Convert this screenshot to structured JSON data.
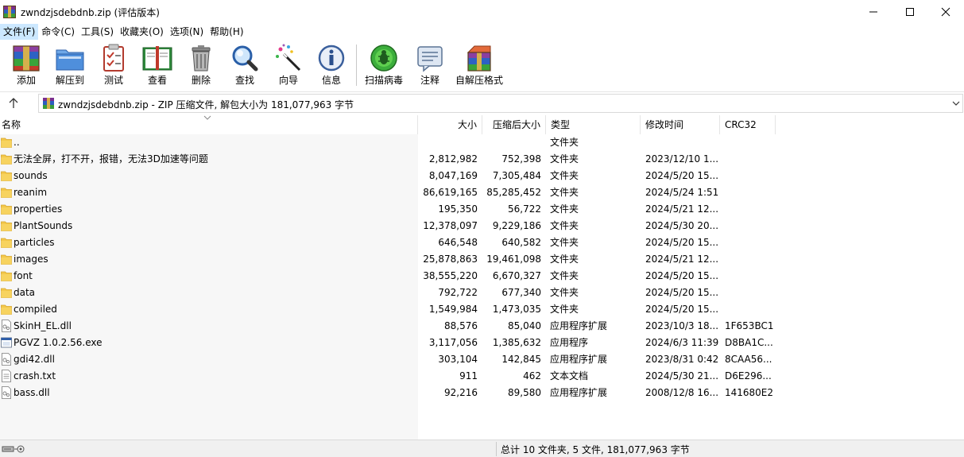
{
  "window": {
    "title": "zwndzjsdebdnb.zip (评估版本)"
  },
  "menu": [
    {
      "label": "文件(F)"
    },
    {
      "label": "命令(C)"
    },
    {
      "label": "工具(S)"
    },
    {
      "label": "收藏夹(O)"
    },
    {
      "label": "选项(N)"
    },
    {
      "label": "帮助(H)"
    }
  ],
  "toolbar": [
    {
      "label": "添加",
      "icon": "add-archive-icon"
    },
    {
      "label": "解压到",
      "icon": "extract-to-icon"
    },
    {
      "label": "测试",
      "icon": "test-icon"
    },
    {
      "label": "查看",
      "icon": "view-book-icon"
    },
    {
      "label": "删除",
      "icon": "trash-icon"
    },
    {
      "label": "查找",
      "icon": "find-magnifier-icon"
    },
    {
      "label": "向导",
      "icon": "wizard-wand-icon"
    },
    {
      "label": "信息",
      "icon": "info-icon"
    },
    {
      "label": "扫描病毒",
      "icon": "virus-scan-icon"
    },
    {
      "label": "注释",
      "icon": "comment-icon"
    },
    {
      "label": "自解压格式",
      "icon": "sfx-icon"
    }
  ],
  "address": {
    "text": "zwndzjsdebdnb.zip - ZIP 压缩文件, 解包大小为 181,077,963 字节"
  },
  "columns": {
    "name": "名称",
    "size": "大小",
    "packed": "压缩后大小",
    "type": "类型",
    "modified": "修改时间",
    "crc": "CRC32"
  },
  "files": [
    {
      "name": "..",
      "size": "",
      "packed": "",
      "type": "文件夹",
      "modified": "",
      "crc": "",
      "kind": "folder"
    },
    {
      "name": "无法全屏，打不开，报错，无法3D加速等问题",
      "size": "2,812,982",
      "packed": "752,398",
      "type": "文件夹",
      "modified": "2023/12/10 1...",
      "crc": "",
      "kind": "folder"
    },
    {
      "name": "sounds",
      "size": "8,047,169",
      "packed": "7,305,484",
      "type": "文件夹",
      "modified": "2024/5/20 15...",
      "crc": "",
      "kind": "folder"
    },
    {
      "name": "reanim",
      "size": "86,619,165",
      "packed": "85,285,452",
      "type": "文件夹",
      "modified": "2024/5/24 1:51",
      "crc": "",
      "kind": "folder"
    },
    {
      "name": "properties",
      "size": "195,350",
      "packed": "56,722",
      "type": "文件夹",
      "modified": "2024/5/21 12...",
      "crc": "",
      "kind": "folder"
    },
    {
      "name": "PlantSounds",
      "size": "12,378,097",
      "packed": "9,229,186",
      "type": "文件夹",
      "modified": "2024/5/30 20...",
      "crc": "",
      "kind": "folder"
    },
    {
      "name": "particles",
      "size": "646,548",
      "packed": "640,582",
      "type": "文件夹",
      "modified": "2024/5/20 15...",
      "crc": "",
      "kind": "folder"
    },
    {
      "name": "images",
      "size": "25,878,863",
      "packed": "19,461,098",
      "type": "文件夹",
      "modified": "2024/5/21 12...",
      "crc": "",
      "kind": "folder"
    },
    {
      "name": "font",
      "size": "38,555,220",
      "packed": "6,670,327",
      "type": "文件夹",
      "modified": "2024/5/20 15...",
      "crc": "",
      "kind": "folder"
    },
    {
      "name": "data",
      "size": "792,722",
      "packed": "677,340",
      "type": "文件夹",
      "modified": "2024/5/20 15...",
      "crc": "",
      "kind": "folder"
    },
    {
      "name": "compiled",
      "size": "1,549,984",
      "packed": "1,473,035",
      "type": "文件夹",
      "modified": "2024/5/20 15...",
      "crc": "",
      "kind": "folder"
    },
    {
      "name": "SkinH_EL.dll",
      "size": "88,576",
      "packed": "85,040",
      "type": "应用程序扩展",
      "modified": "2023/10/3 18...",
      "crc": "1F653BC1",
      "kind": "dll"
    },
    {
      "name": "PGVZ 1.0.2.56.exe",
      "size": "3,117,056",
      "packed": "1,385,632",
      "type": "应用程序",
      "modified": "2024/6/3 11:39",
      "crc": "D8BA1C...",
      "kind": "exe"
    },
    {
      "name": "gdi42.dll",
      "size": "303,104",
      "packed": "142,845",
      "type": "应用程序扩展",
      "modified": "2023/8/31 0:42",
      "crc": "8CAA56...",
      "kind": "dll"
    },
    {
      "name": "crash.txt",
      "size": "911",
      "packed": "462",
      "type": "文本文档",
      "modified": "2024/5/30 21...",
      "crc": "D6E296...",
      "kind": "txt"
    },
    {
      "name": "bass.dll",
      "size": "92,216",
      "packed": "89,580",
      "type": "应用程序扩展",
      "modified": "2008/12/8 16...",
      "crc": "141680E2",
      "kind": "dll"
    }
  ],
  "status": {
    "text": "总计 10 文件夹, 5 文件, 181,077,963 字节"
  }
}
